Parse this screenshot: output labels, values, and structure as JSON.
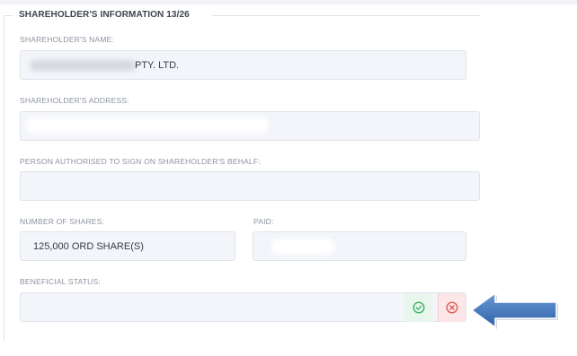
{
  "section": {
    "title": "SHAREHOLDER'S INFORMATION",
    "counter": "13/26"
  },
  "fields": {
    "name": {
      "label": "SHAREHOLDER'S NAME:",
      "value": "PTY. LTD."
    },
    "address": {
      "label": "SHAREHOLDER'S ADDRESS:",
      "value": ""
    },
    "authorised": {
      "label": "PERSON AUTHORISED TO SIGN ON SHAREHOLDER'S BEHALF:",
      "value": ""
    },
    "shares": {
      "label": "NUMBER OF SHARES:",
      "value": "125,000 ORD SHARE(S)"
    },
    "paid": {
      "label": "PAID:",
      "value": ""
    },
    "beneficial": {
      "label": "BENEFICIAL STATUS:",
      "value": ""
    }
  },
  "actions": {
    "confirm_icon": "check-circle-icon",
    "cancel_icon": "x-circle-icon",
    "confirm_color": "#3fb46a",
    "cancel_color": "#e25a5a"
  },
  "annotation": {
    "arrow_color": "#3e73b8",
    "arrow_icon": "left-arrow-icon"
  }
}
